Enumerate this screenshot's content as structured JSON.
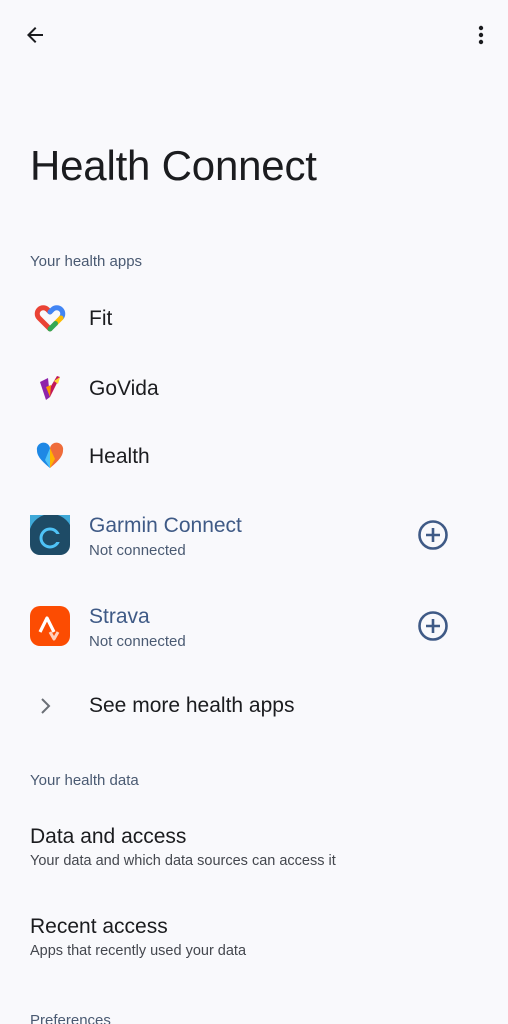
{
  "header": {
    "back_icon": "arrow-back-icon",
    "more_icon": "more-vert-icon",
    "title": "Health Connect"
  },
  "sections": {
    "apps_header": "Your health apps",
    "data_header": "Your health data",
    "prefs_header": "Preferences"
  },
  "apps": [
    {
      "name": "Fit",
      "subtitle": "",
      "icon": "google-fit-icon",
      "connected": true
    },
    {
      "name": "GoVida",
      "subtitle": "",
      "icon": "govida-icon",
      "connected": true
    },
    {
      "name": "Health",
      "subtitle": "",
      "icon": "health-icon",
      "connected": true
    },
    {
      "name": "Garmin Connect",
      "subtitle": "Not connected",
      "icon": "garmin-connect-icon",
      "connected": false
    },
    {
      "name": "Strava",
      "subtitle": "Not connected",
      "icon": "strava-icon",
      "connected": false
    }
  ],
  "see_more": {
    "label": "See more health apps",
    "icon": "chevron-right-icon"
  },
  "data_items": [
    {
      "title": "Data and access",
      "subtitle": "Your data and which data sources can access it"
    },
    {
      "title": "Recent access",
      "subtitle": "Apps that recently used your data"
    }
  ],
  "colors": {
    "background": "#f9f9fc",
    "accent": "#3f5a86",
    "secondary_text": "#4a5a72",
    "strava": "#fc4c02",
    "garmin": "#1e4b66"
  }
}
